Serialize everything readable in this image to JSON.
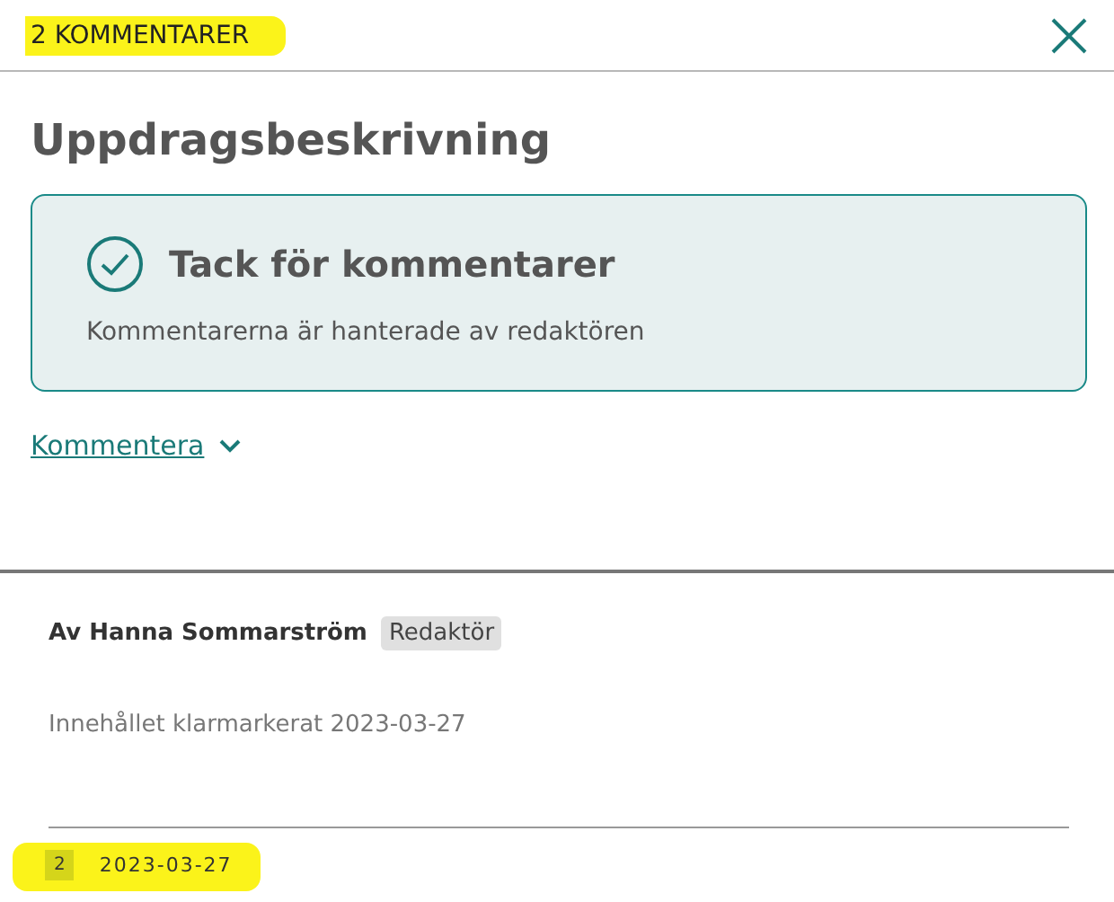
{
  "header": {
    "title": "2 KOMMENTARER"
  },
  "page_title": "Uppdragsbeskrivning",
  "notice": {
    "heading": "Tack för kommentarer",
    "text": "Kommentarerna är hanterade av redaktören"
  },
  "comment_toggle": {
    "label": "Kommentera",
    "expanded": false
  },
  "comment": {
    "author": "Av Hanna Sommarström",
    "role": "Redaktör",
    "body": "Innehållet klarmarkerat 2023-03-27",
    "number": "2",
    "date": "2023-03-27"
  }
}
